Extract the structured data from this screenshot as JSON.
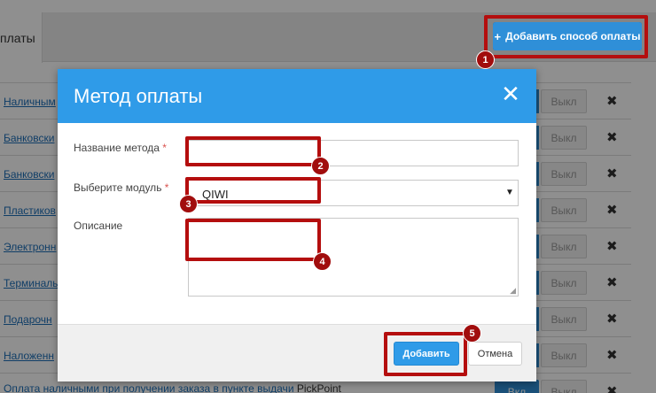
{
  "background": {
    "tab_label": "платы",
    "add_button": {
      "icon": "plus-icon",
      "label": "Добавить способ оплаты"
    },
    "rows": [
      {
        "name": "Наличным",
        "suffix": "",
        "on": "",
        "off": "Выкл"
      },
      {
        "name": "Банковски",
        "suffix": "",
        "on": "",
        "off": "Выкл"
      },
      {
        "name": "Банковски",
        "suffix": "",
        "on": "",
        "off": "Выкл"
      },
      {
        "name": "Пластиков",
        "suffix": "",
        "on": "",
        "off": "Выкл"
      },
      {
        "name": "Электронн",
        "suffix": "",
        "on": "",
        "off": "Выкл"
      },
      {
        "name": "Терминалы",
        "suffix": "",
        "on": "",
        "off": "Выкл"
      },
      {
        "name": "Подарочн",
        "suffix": "",
        "on": "",
        "off": "Выкл"
      },
      {
        "name": "Наложенн",
        "suffix": "",
        "on": "",
        "off": "Выкл"
      },
      {
        "name": "Оплата наличными при получении заказа в пункте выдачи",
        "suffix": "PickPoint",
        "on": "Вкл",
        "off": "Выкл"
      }
    ],
    "delete_icon": "close-icon"
  },
  "modal": {
    "title": "Метод оплаты",
    "close_icon": "close-icon",
    "fields": {
      "name_label": "Название метода",
      "name_value": "",
      "module_label": "Выберите модуль",
      "module_value": "QIWI",
      "description_label": "Описание",
      "description_value": "",
      "required_mark": "*"
    },
    "submit_label": "Добавить",
    "cancel_label": "Отмена"
  },
  "annotations": {
    "steps": [
      "1",
      "2",
      "3",
      "4",
      "5"
    ],
    "highlight_color": "#b40e0e"
  },
  "colors": {
    "primary": "#2f9be8",
    "background_button": "#2f8fd8",
    "required": "#d9534f",
    "overlay": "rgba(0,0,0,0.44)"
  }
}
